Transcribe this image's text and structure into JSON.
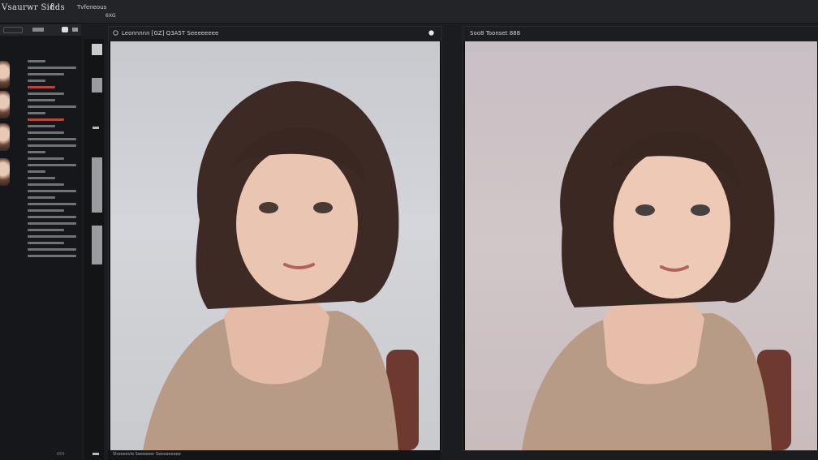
{
  "window": {
    "title": "Vsaurwr Sidds",
    "menu_mark": "f ·",
    "menu_top": "Tvfeneous",
    "menu_sub": "6XG"
  },
  "panel_left": {
    "header": "Leonnnnn [GZ] Q3A5T Seeeeeeee",
    "footer": "Sheeeevle Seeeeeer Seeeeeeeee"
  },
  "panel_right": {
    "header": "Soo8 Toonset 888"
  },
  "sidebar": {
    "footer": "666"
  },
  "colors": {
    "accent_red": "#b9453b",
    "panel_bg": "#0f1012"
  },
  "icons": [
    "chevron-icon",
    "pin-icon",
    "more-icon",
    "collapse-icon",
    "record-icon"
  ]
}
